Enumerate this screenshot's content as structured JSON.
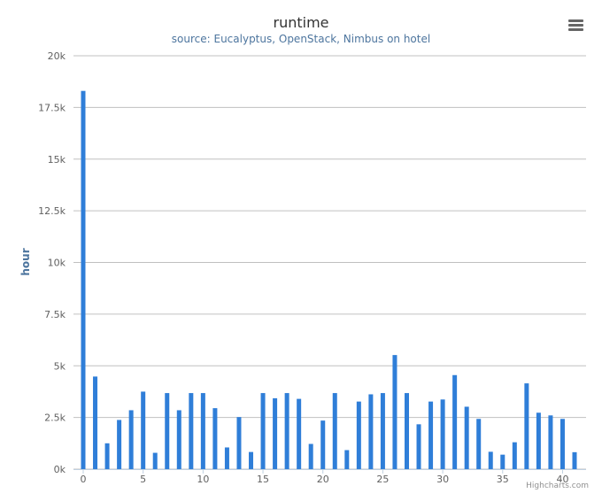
{
  "chart": {
    "title": "runtime",
    "subtitle": "source: Eucalyptus, OpenStack, Nimbus on hotel",
    "credits": "Highcharts.com",
    "menu_icon": "hamburger-menu-icon"
  },
  "chart_data": {
    "type": "bar",
    "title": "runtime",
    "subtitle": "source: Eucalyptus, OpenStack, Nimbus on hotel",
    "xlabel": "",
    "ylabel": "hour",
    "xlim": [
      0,
      41
    ],
    "ylim": [
      0,
      20000
    ],
    "x_ticks": [
      "0",
      "5",
      "10",
      "15",
      "20",
      "25",
      "30",
      "35",
      "40"
    ],
    "y_ticks": [
      "0k",
      "2.5k",
      "5k",
      "7.5k",
      "10k",
      "12.5k",
      "15k",
      "17.5k",
      "20k"
    ],
    "grid": "horizontal",
    "bar_color": "#2f7ed8",
    "x": [
      0,
      1,
      2,
      3,
      4,
      5,
      6,
      7,
      8,
      9,
      10,
      11,
      12,
      13,
      14,
      15,
      16,
      17,
      18,
      19,
      20,
      21,
      22,
      23,
      24,
      25,
      26,
      27,
      28,
      29,
      30,
      31,
      32,
      33,
      34,
      35,
      36,
      37,
      38,
      39,
      40,
      41
    ],
    "values": [
      18300,
      4480,
      1250,
      2380,
      2850,
      3750,
      790,
      3680,
      2850,
      3680,
      3680,
      2950,
      1050,
      2520,
      830,
      3680,
      3430,
      3680,
      3400,
      1220,
      2350,
      3680,
      920,
      3270,
      3620,
      3680,
      5520,
      3680,
      2170,
      3270,
      3370,
      4550,
      3020,
      2430,
      840,
      700,
      1300,
      4150,
      2730,
      2600,
      2430,
      820
    ]
  }
}
